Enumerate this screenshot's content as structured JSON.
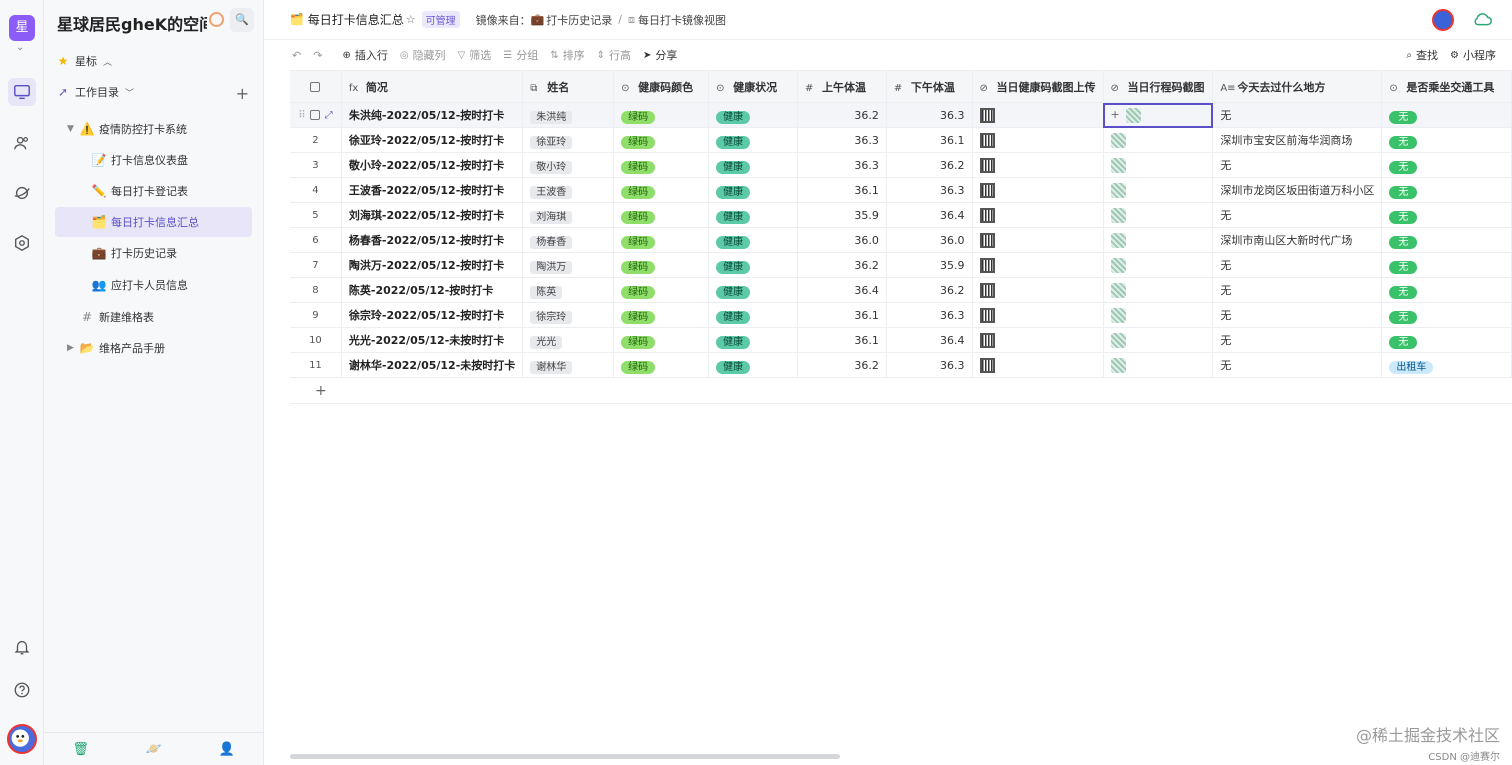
{
  "rail": {
    "space_letter": "星",
    "chevron": "⌄",
    "items": [
      "monitor-icon",
      "team-icon",
      "explore-icon",
      "settings-icon"
    ],
    "bottom": [
      "bell-icon",
      "help-icon"
    ]
  },
  "sidebar": {
    "space_title": "星球居民gheK的空间...",
    "search_glyph": "🔍",
    "starred": "星标",
    "workspace": "工作目录",
    "tree": [
      {
        "label": "疫情防控打卡系统",
        "icon": "⚠️"
      },
      {
        "label": "打卡信息仪表盘",
        "icon": "📝"
      },
      {
        "label": "每日打卡登记表",
        "icon": "✏️"
      },
      {
        "label": "每日打卡信息汇总",
        "icon": "🗂️"
      },
      {
        "label": "打卡历史记录",
        "icon": "💼"
      },
      {
        "label": "应打卡人员信息",
        "icon": "👥"
      },
      {
        "label": "新建维格表",
        "icon": "#"
      },
      {
        "label": "维格产品手册",
        "icon": "📂"
      }
    ],
    "footer": [
      "trash-icon",
      "planet-icon",
      "invite-user-icon"
    ]
  },
  "topbar": {
    "icon": "🗂️",
    "title": "每日打卡信息汇总",
    "star": "☆",
    "permission": "可管理",
    "mirror_from": "镜像来自：",
    "mirror_source_icon": "💼",
    "mirror_source": "打卡历史记录",
    "separator": "/",
    "mirror_view": "每日打卡镜像视图"
  },
  "toolbar": {
    "undo": "↶",
    "redo": "↷",
    "insert_row": "插入行",
    "hide_columns": "隐藏列",
    "filter": "筛选",
    "group": "分组",
    "sort": "排序",
    "row_height": "行高",
    "share": "分享",
    "find": "查找",
    "mini_program": "小程序"
  },
  "table": {
    "columns": [
      {
        "icon": "fx",
        "label": "简况"
      },
      {
        "icon": "⧉",
        "label": "姓名"
      },
      {
        "icon": "⊙",
        "label": "健康码颜色"
      },
      {
        "icon": "⊙",
        "label": "健康状况"
      },
      {
        "icon": "#",
        "label": "上午体温"
      },
      {
        "icon": "#",
        "label": "下午体温"
      },
      {
        "icon": "⊘",
        "label": "当日健康码截图上传"
      },
      {
        "icon": "⊘",
        "label": "当日行程码截图"
      },
      {
        "icon": "A≡",
        "label": "今天去过什么地方"
      },
      {
        "icon": "⊙",
        "label": "是否乘坐交通工具"
      }
    ],
    "rows": [
      {
        "idx": "",
        "summary": "朱洪纯-2022/05/12-按时打卡",
        "name": "朱洪纯",
        "code": "绿码",
        "health": "健康",
        "am": "36.2",
        "pm": "36.3",
        "place": "无",
        "transport": "无"
      },
      {
        "idx": "2",
        "summary": "徐亚玲-2022/05/12-按时打卡",
        "name": "徐亚玲",
        "code": "绿码",
        "health": "健康",
        "am": "36.3",
        "pm": "36.1",
        "place": "深圳市宝安区前海华润商场",
        "transport": "无"
      },
      {
        "idx": "3",
        "summary": "敬小玲-2022/05/12-按时打卡",
        "name": "敬小玲",
        "code": "绿码",
        "health": "健康",
        "am": "36.3",
        "pm": "36.2",
        "place": "无",
        "transport": "无"
      },
      {
        "idx": "4",
        "summary": "王波香-2022/05/12-按时打卡",
        "name": "王波香",
        "code": "绿码",
        "health": "健康",
        "am": "36.1",
        "pm": "36.3",
        "place": "深圳市龙岗区坂田街道万科小区",
        "transport": "无"
      },
      {
        "idx": "5",
        "summary": "刘海琪-2022/05/12-按时打卡",
        "name": "刘海琪",
        "code": "绿码",
        "health": "健康",
        "am": "35.9",
        "pm": "36.4",
        "place": "无",
        "transport": "无"
      },
      {
        "idx": "6",
        "summary": "杨春香-2022/05/12-按时打卡",
        "name": "杨春香",
        "code": "绿码",
        "health": "健康",
        "am": "36.0",
        "pm": "36.0",
        "place": "深圳市南山区大新时代广场",
        "transport": "无"
      },
      {
        "idx": "7",
        "summary": "陶洪万-2022/05/12-按时打卡",
        "name": "陶洪万",
        "code": "绿码",
        "health": "健康",
        "am": "36.2",
        "pm": "35.9",
        "place": "无",
        "transport": "无"
      },
      {
        "idx": "8",
        "summary": "陈英-2022/05/12-按时打卡",
        "name": "陈英",
        "code": "绿码",
        "health": "健康",
        "am": "36.4",
        "pm": "36.2",
        "place": "无",
        "transport": "无"
      },
      {
        "idx": "9",
        "summary": "徐宗玲-2022/05/12-按时打卡",
        "name": "徐宗玲",
        "code": "绿码",
        "health": "健康",
        "am": "36.1",
        "pm": "36.3",
        "place": "无",
        "transport": "无"
      },
      {
        "idx": "10",
        "summary": "光光-2022/05/12-未按时打卡",
        "name": "光光",
        "code": "绿码",
        "health": "健康",
        "am": "36.1",
        "pm": "36.4",
        "place": "无",
        "transport": "无"
      },
      {
        "idx": "11",
        "summary": "谢林华-2022/05/12-未按时打卡",
        "name": "谢林华",
        "code": "绿码",
        "health": "健康",
        "am": "36.2",
        "pm": "36.3",
        "place": "无",
        "transport": "出租车"
      }
    ],
    "add_row": "+"
  },
  "watermark": {
    "line1": "@稀土掘金技术社区",
    "line2": "CSDN @迪赛尔"
  },
  "colors": {
    "accent": "#5b4fc7",
    "green_code": "#8fde6a",
    "health": "#5cc9a7",
    "transport_no": "#3ac26b",
    "taxi": "#cce9fb"
  }
}
